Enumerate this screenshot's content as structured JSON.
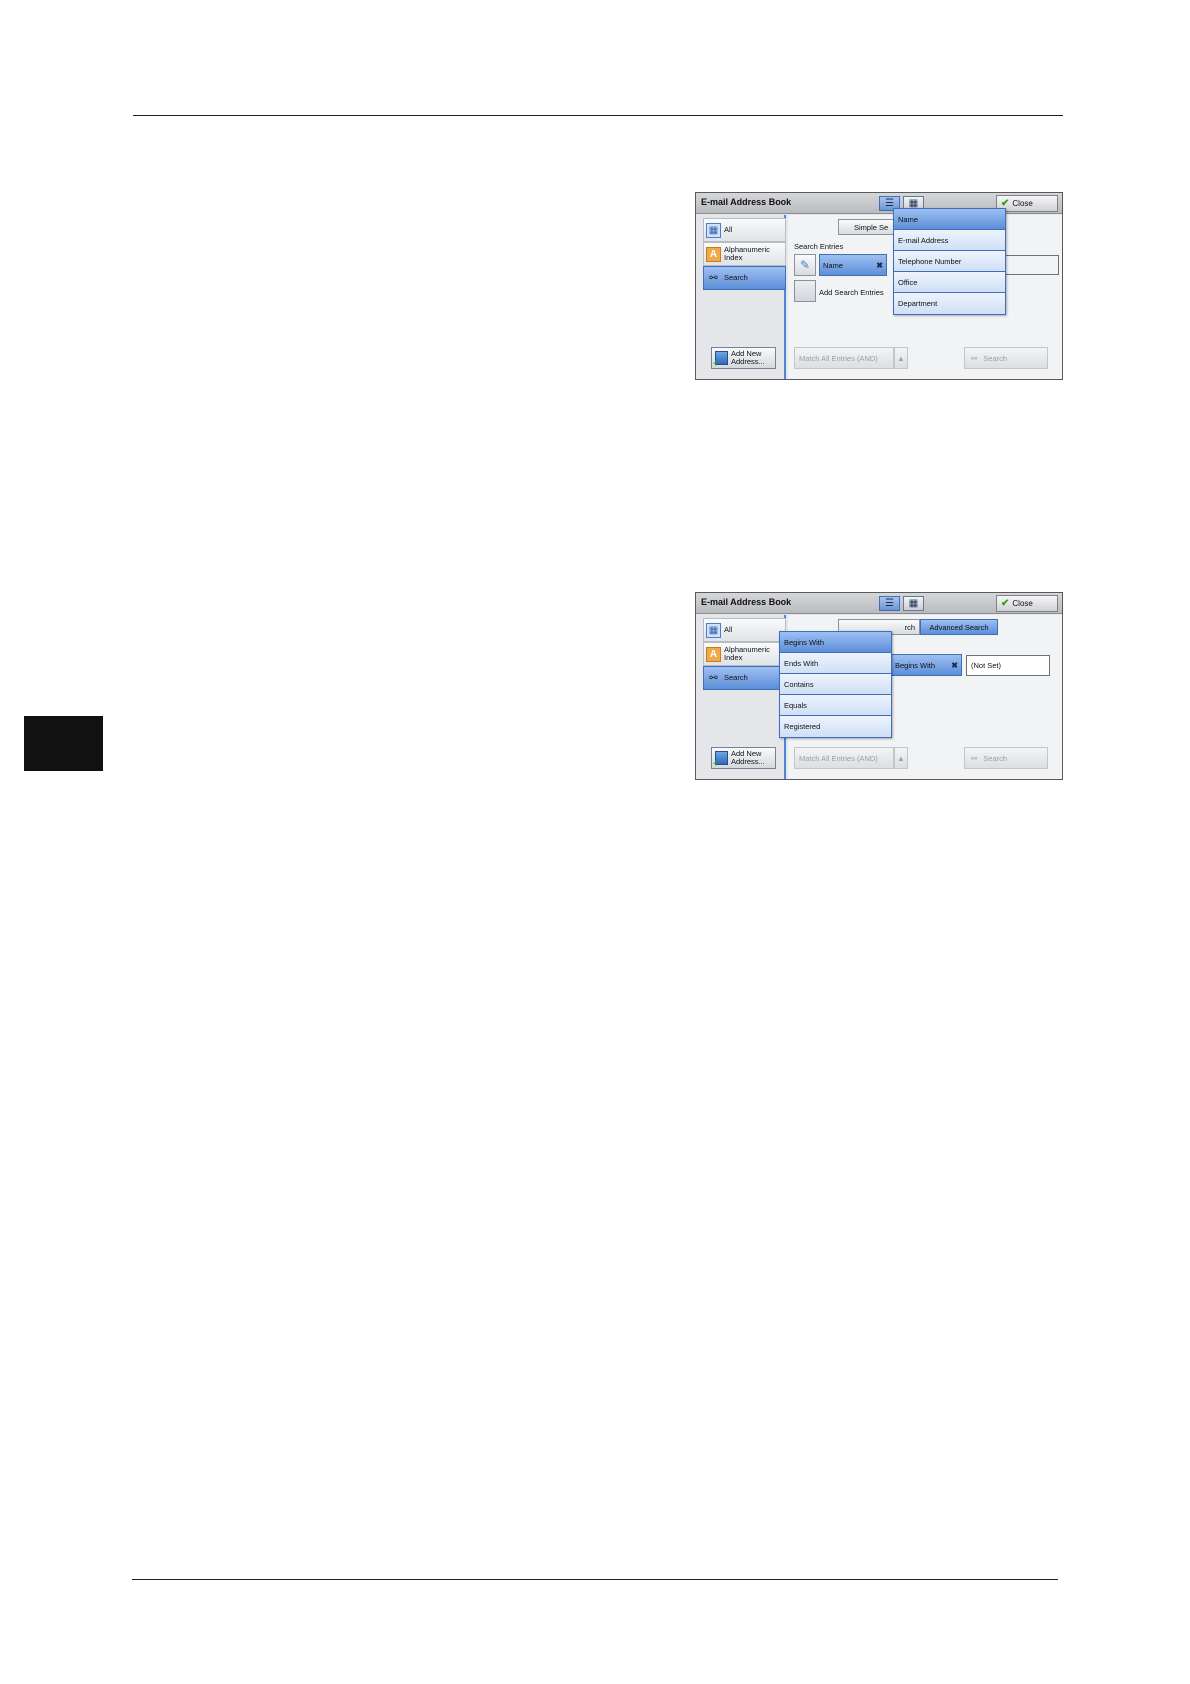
{
  "panel1": {
    "title": "E-mail Address Book",
    "close_label": "Close",
    "nav": {
      "all": "All",
      "alpha_line1": "Alphanumeric",
      "alpha_line2": "Index",
      "search": "Search"
    },
    "add_line1": "Add New",
    "add_line2": "Address...",
    "simple_search_label": "Simple Se",
    "search_entries_label": "Search Entries",
    "field_button_label": "Name",
    "add_search_entries_label": "Add Search Entries",
    "match_label": "Match All Entries (AND)",
    "search_button_label": "Search",
    "dropdown_items": [
      "Name",
      "E-mail Address",
      "Telephone Number",
      "Office",
      "Department"
    ],
    "dropdown_selected": "Name"
  },
  "panel2": {
    "title": "E-mail Address Book",
    "close_label": "Close",
    "nav": {
      "all": "All",
      "alpha_line1": "Alphanumeric",
      "alpha_line2": "Index",
      "search": "Search"
    },
    "add_line1": "Add New",
    "add_line2": "Address...",
    "simple_search_partial": "rch",
    "advanced_search_label": "Advanced Search",
    "condition_button_label": "Begins With",
    "value_input": "(Not Set)",
    "match_label": "Match All Entries (AND)",
    "search_button_label": "Search",
    "dropdown_items": [
      "Begins With",
      "Ends With",
      "Contains",
      "Equals",
      "Registered"
    ],
    "dropdown_selected": "Begins With"
  }
}
